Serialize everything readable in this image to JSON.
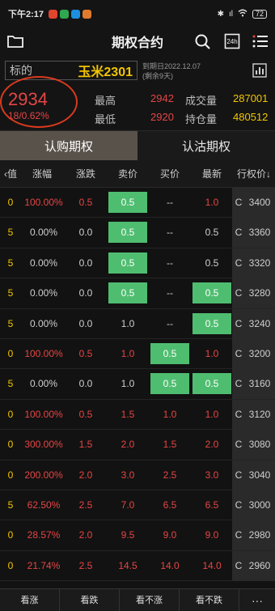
{
  "status_bar": {
    "time": "下午2:17",
    "signal": "ıl",
    "wifi": "WiFi",
    "battery": "72"
  },
  "nav": {
    "title": "期权合约",
    "left_icon": "folder-icon",
    "search_icon": "search-icon",
    "hours_icon": "24h-icon",
    "hours_label": "24h",
    "menu_icon": "menu-icon"
  },
  "quote": {
    "underlying_label": "标的",
    "underlying_name": "玉米2301",
    "expiry_line1": "到期日2022.12.07",
    "expiry_line2": "(剩余9天)",
    "price": "2934",
    "change": "18/0.62%",
    "high_label": "最高",
    "high_value": "2942",
    "low_label": "最低",
    "low_value": "2920",
    "volume_label": "成交量",
    "volume_value": "287001",
    "oi_label": "持仓量",
    "oi_value": "480512",
    "chart_icon": "chart-icon"
  },
  "tabs": {
    "call": "认购期权",
    "put": "认沽期权"
  },
  "columns": {
    "value": "‹值",
    "pct": "涨幅",
    "chg": "涨跌",
    "ask": "卖价",
    "bid": "买价",
    "last": "最新",
    "strike": "行权价↓"
  },
  "rows": [
    {
      "value": "0",
      "pct": "100.00%",
      "chg": "0.5",
      "ask": "0.5",
      "bid": "--",
      "last": "1.0",
      "type": "C",
      "strike": "3400",
      "ask_pill": true,
      "bid_pill": false,
      "last_pill": false,
      "color": "red"
    },
    {
      "value": "5",
      "pct": "0.00%",
      "chg": "0.0",
      "ask": "0.5",
      "bid": "--",
      "last": "0.5",
      "type": "C",
      "strike": "3360",
      "ask_pill": true,
      "bid_pill": false,
      "last_pill": false,
      "color": "grey"
    },
    {
      "value": "5",
      "pct": "0.00%",
      "chg": "0.0",
      "ask": "0.5",
      "bid": "--",
      "last": "0.5",
      "type": "C",
      "strike": "3320",
      "ask_pill": true,
      "bid_pill": false,
      "last_pill": false,
      "color": "grey"
    },
    {
      "value": "5",
      "pct": "0.00%",
      "chg": "0.0",
      "ask": "0.5",
      "bid": "--",
      "last": "0.5",
      "type": "C",
      "strike": "3280",
      "ask_pill": true,
      "bid_pill": false,
      "last_pill": true,
      "color": "grey"
    },
    {
      "value": "5",
      "pct": "0.00%",
      "chg": "0.0",
      "ask": "1.0",
      "bid": "--",
      "last": "0.5",
      "type": "C",
      "strike": "3240",
      "ask_pill": false,
      "bid_pill": false,
      "last_pill": true,
      "color": "grey"
    },
    {
      "value": "0",
      "pct": "100.00%",
      "chg": "0.5",
      "ask": "1.0",
      "bid": "0.5",
      "last": "1.0",
      "type": "C",
      "strike": "3200",
      "ask_pill": false,
      "bid_pill": true,
      "last_pill": false,
      "color": "red"
    },
    {
      "value": "5",
      "pct": "0.00%",
      "chg": "0.0",
      "ask": "1.0",
      "bid": "0.5",
      "last": "0.5",
      "type": "C",
      "strike": "3160",
      "ask_pill": false,
      "bid_pill": true,
      "last_pill": true,
      "color": "grey"
    },
    {
      "value": "0",
      "pct": "100.00%",
      "chg": "0.5",
      "ask": "1.5",
      "bid": "1.0",
      "last": "1.0",
      "type": "C",
      "strike": "3120",
      "ask_pill": false,
      "bid_pill": false,
      "last_pill": false,
      "color": "red"
    },
    {
      "value": "0",
      "pct": "300.00%",
      "chg": "1.5",
      "ask": "2.0",
      "bid": "1.5",
      "last": "2.0",
      "type": "C",
      "strike": "3080",
      "ask_pill": false,
      "bid_pill": false,
      "last_pill": false,
      "color": "red"
    },
    {
      "value": "0",
      "pct": "200.00%",
      "chg": "2.0",
      "ask": "3.0",
      "bid": "2.5",
      "last": "3.0",
      "type": "C",
      "strike": "3040",
      "ask_pill": false,
      "bid_pill": false,
      "last_pill": false,
      "color": "red"
    },
    {
      "value": "5",
      "pct": "62.50%",
      "chg": "2.5",
      "ask": "7.0",
      "bid": "6.5",
      "last": "6.5",
      "type": "C",
      "strike": "3000",
      "ask_pill": false,
      "bid_pill": false,
      "last_pill": false,
      "color": "red"
    },
    {
      "value": "0",
      "pct": "28.57%",
      "chg": "2.0",
      "ask": "9.5",
      "bid": "9.0",
      "last": "9.0",
      "type": "C",
      "strike": "2980",
      "ask_pill": false,
      "bid_pill": false,
      "last_pill": false,
      "color": "red"
    },
    {
      "value": "0",
      "pct": "21.74%",
      "chg": "2.5",
      "ask": "14.5",
      "bid": "14.0",
      "last": "14.0",
      "type": "C",
      "strike": "2960",
      "ask_pill": false,
      "bid_pill": false,
      "last_pill": false,
      "color": "red"
    }
  ],
  "bottom": {
    "b1": "看涨",
    "b2": "看跌",
    "b3": "看不涨",
    "b4": "看不跌",
    "more": "···"
  },
  "colors": {
    "up": "#e64545",
    "pill": "#4fbd70",
    "accent": "#f2c500",
    "tab_active": "#59524b"
  }
}
